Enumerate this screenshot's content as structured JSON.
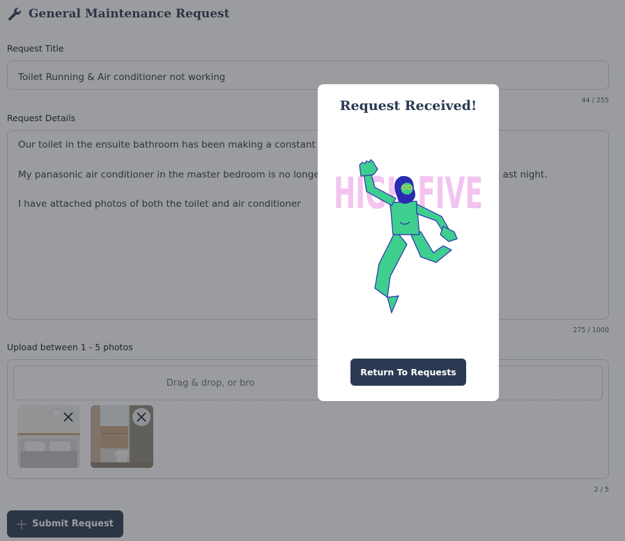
{
  "header": {
    "title": "General Maintenance Request",
    "icon": "wrench-icon"
  },
  "form": {
    "request_title": {
      "label": "Request Title",
      "value": "Toilet Running & Air conditioner not working",
      "counter": "44 / 255"
    },
    "request_details": {
      "label": "Request Details",
      "lines": [
        "Our toilet in the ensuite bathroom has been making a constant r",
        "My panasonic air conditioner in the master bedroom is no longe",
        "I have attached photos of both the toilet and air conditioner"
      ],
      "hidden_fragment": "ast night.",
      "counter": "275 / 1000"
    },
    "upload": {
      "label": "Upload between 1 - 5 photos",
      "dropzone_text": "Drag & drop, or bro",
      "counter": "2 / 5",
      "photos": [
        {
          "subject": "bedroom-with-air-conditioner"
        },
        {
          "subject": "bathroom-with-toilet"
        }
      ]
    },
    "submit_label": "Submit Request"
  },
  "modal": {
    "title": "Request Received!",
    "illustration_text": "HIGH FIVE",
    "button_label": "Return To Requests"
  },
  "colors": {
    "primary": "#2b3a52",
    "illustration_green": "#3ecf8e",
    "illustration_pink": "#f3c4f0",
    "illustration_outline": "#2a2ab3"
  }
}
